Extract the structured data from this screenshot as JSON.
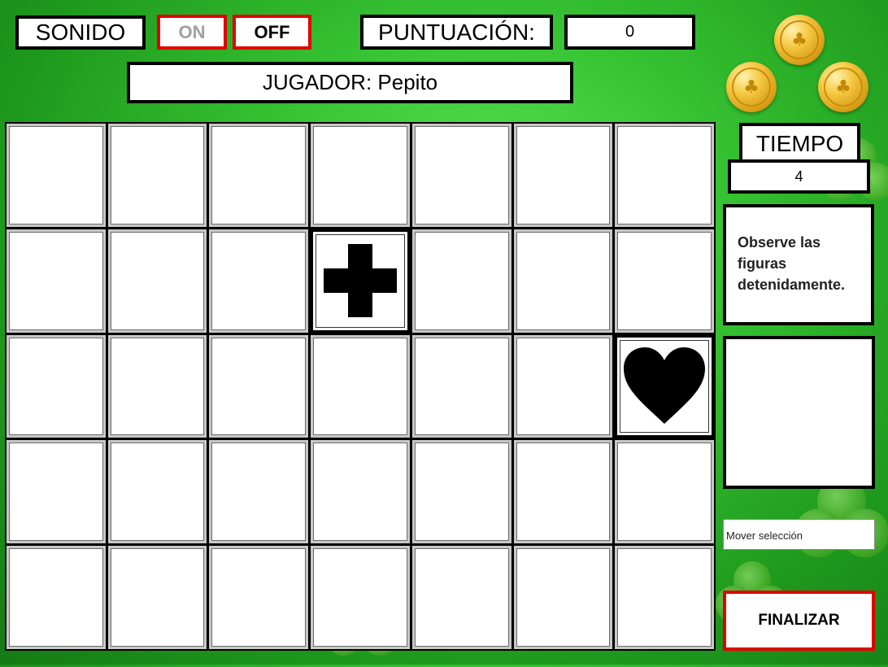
{
  "sound": {
    "label": "SONIDO",
    "on_label": "ON",
    "off_label": "OFF",
    "selected": "OFF"
  },
  "score": {
    "label": "PUNTUACIÓN:",
    "value": "0"
  },
  "player": {
    "label": "JUGADOR: Pepito"
  },
  "timer": {
    "label": "TIEMPO",
    "value": "4"
  },
  "instructions": {
    "text": "Observe las figuras detenidamente."
  },
  "selection": {
    "placeholder": "Mover selección"
  },
  "finish_button": {
    "label": "FINALIZAR"
  },
  "board": {
    "rows": 5,
    "cols": 7,
    "revealed": [
      {
        "row": 2,
        "col": 4,
        "shape": "cross-icon"
      },
      {
        "row": 3,
        "col": 7,
        "shape": "heart-icon"
      }
    ]
  },
  "decorations": {
    "coins": [
      "clover-coin-icon",
      "clover-coin-icon",
      "clover-coin-icon"
    ]
  },
  "colors": {
    "background": "#36c232",
    "accent_border": "#e00000",
    "on_text": "#a0a0a0"
  }
}
